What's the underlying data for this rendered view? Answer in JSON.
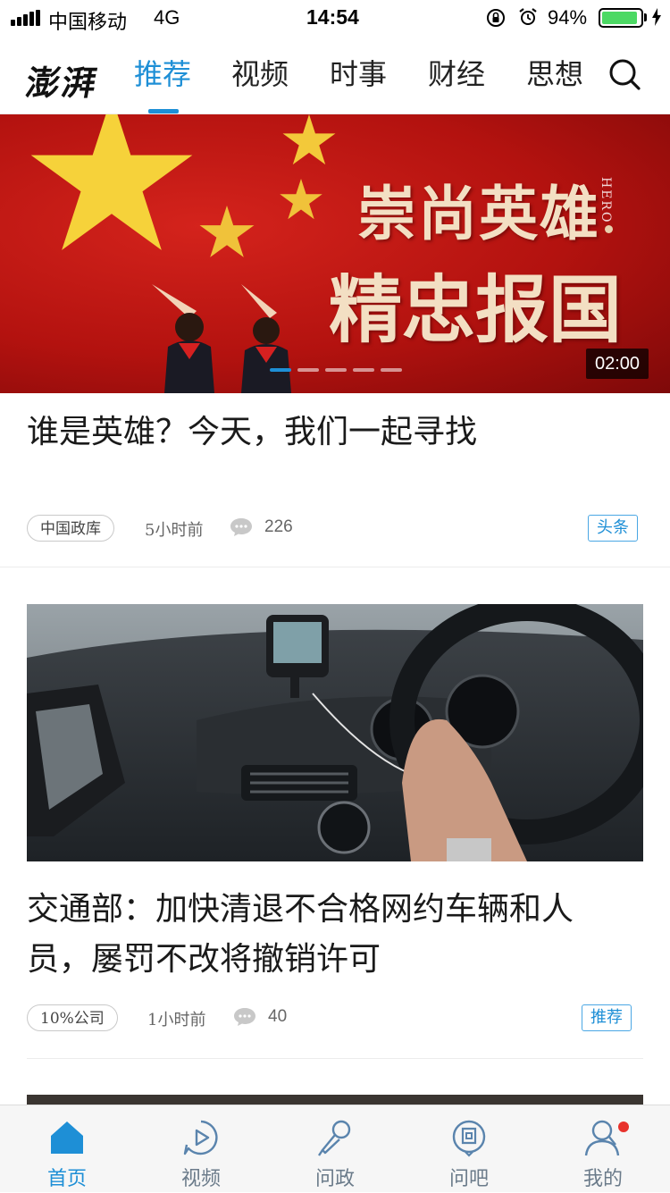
{
  "status_bar": {
    "carrier": "中国移动",
    "network": "4G",
    "time": "14:54",
    "battery_percent": "94%",
    "battery_level": 0.94
  },
  "header": {
    "logo": "澎湃",
    "tabs": [
      {
        "label": "推荐",
        "active": true
      },
      {
        "label": "视频",
        "active": false
      },
      {
        "label": "时事",
        "active": false
      },
      {
        "label": "财经",
        "active": false
      },
      {
        "label": "思想",
        "active": false
      }
    ],
    "search_icon": "search-icon"
  },
  "banner": {
    "line1": "崇尚英雄",
    "line2": "精忠报国",
    "side_word": "HERO",
    "duration": "02:00",
    "carousel_count": 5,
    "carousel_active_index": 0
  },
  "articles": [
    {
      "title": "谁是英雄？今天，我们一起寻找",
      "source": "中国政库",
      "time": "5小时前",
      "comments": "226",
      "tag": "头条"
    },
    {
      "title_line1": "交通部：加快清退不合格网约车辆和人",
      "title_line2": "员，屡罚不改将撤销许可",
      "source": "10%公司",
      "time": "1小时前",
      "comments": "40",
      "tag": "推荐"
    }
  ],
  "tabbar": {
    "items": [
      {
        "label": "首页",
        "icon": "home-icon",
        "active": true
      },
      {
        "label": "视频",
        "icon": "video-play-icon",
        "active": false
      },
      {
        "label": "问政",
        "icon": "microphone-icon",
        "active": false
      },
      {
        "label": "问吧",
        "icon": "question-bubble-icon",
        "active": false
      },
      {
        "label": "我的",
        "icon": "user-icon",
        "active": false
      }
    ]
  },
  "colors": {
    "accent": "#1e8fd6",
    "banner_red": "#c4170f",
    "notification": "#e8322c",
    "battery_green": "#4cd964"
  }
}
